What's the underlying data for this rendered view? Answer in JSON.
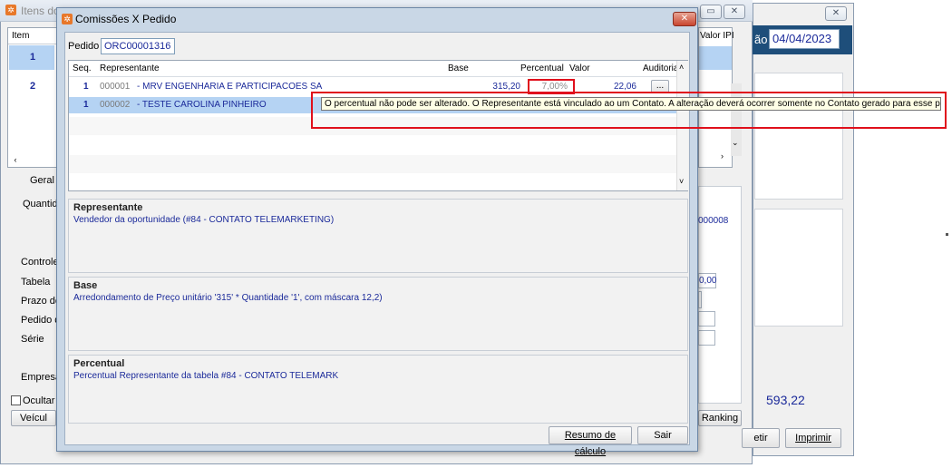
{
  "background_window": {
    "title": "Itens do",
    "grid_headers": {
      "item": "Item",
      "valor_ipi": "Valor IPI"
    },
    "rows": [
      {
        "item": "1"
      },
      {
        "item": "2"
      }
    ],
    "left_labels": [
      "Geral",
      "Quantida",
      "Controle",
      "Tabela",
      "Prazo de",
      "Pedido de",
      "Série",
      "Empresa"
    ],
    "ocultar_label": "Ocultar d",
    "veiculo_button": "Veícul",
    "ranking_button": "Ranking",
    "value_code": "000008",
    "value_field": "0,00"
  },
  "right_window": {
    "date_label": "ão",
    "date_value": "04/04/2023",
    "total": "593,22",
    "repetir_button": "etir",
    "imprimir_button": "Imprimir"
  },
  "dialog": {
    "title": "Comissões X Pedido",
    "pedido_label": "Pedido",
    "pedido_value": "ORC00001316",
    "columns": {
      "seq": "Seq.",
      "representante": "Representante",
      "base": "Base",
      "percentual": "Percentual",
      "valor": "Valor",
      "auditoria": "Auditoria"
    },
    "rows": [
      {
        "seq": "1",
        "code": "000001",
        "name": "- MRV ENGENHARIA E PARTICIPACOES SA",
        "base": "315,20",
        "percentual": "7,00%",
        "valor": "22,06",
        "auditoria": "..."
      },
      {
        "seq": "1",
        "code": "000002",
        "name": "- TESTE CAROLINA PINHEIRO",
        "base": "",
        "percentual": "",
        "valor": "",
        "auditoria": ""
      }
    ],
    "tooltip": "O percentual não pode ser alterado. O Representante está vinculado ao um Contato. A alteração deverá ocorrer somente no Contato gerado para esse pedido.",
    "panels": [
      {
        "title": "Representante",
        "text": "Vendedor da oportunidade (#84 - CONTATO TELEMARKETING)"
      },
      {
        "title": "Base",
        "text": "Arredondamento de Preço unitário '315' * Quantidade '1', com máscara 12,2)"
      },
      {
        "title": "Percentual",
        "text": "Percentual Representante da tabela #84 - CONTATO TELEMARK"
      }
    ],
    "resumo_button": "Resumo de cálculo",
    "sair_button": "Sair"
  },
  "colors": {
    "highlight_row": "#b5d3f3",
    "link_blue": "#1b2a9a",
    "annotation_red": "#e0101c",
    "tooltip_bg": "#ffffe6"
  }
}
